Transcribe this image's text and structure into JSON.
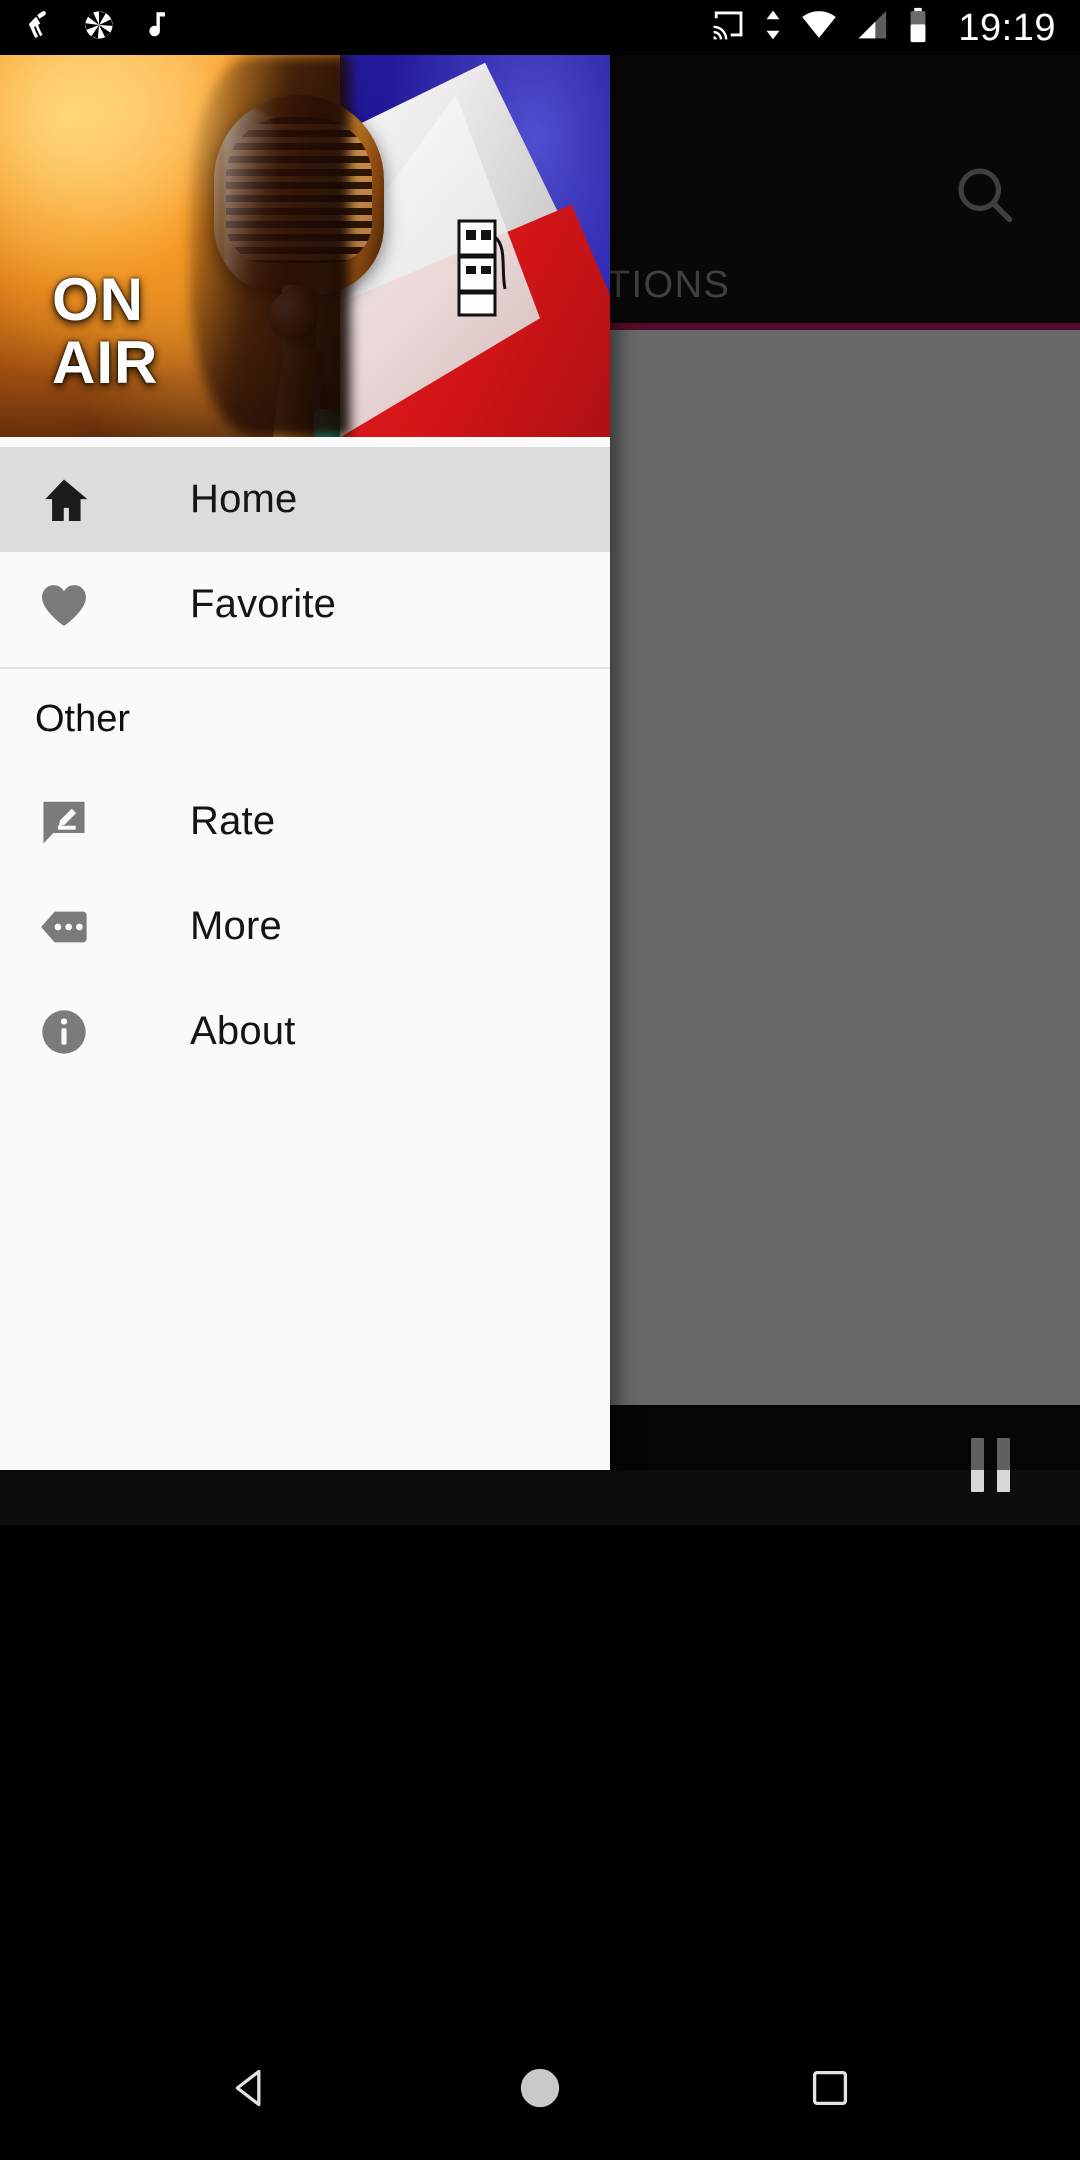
{
  "status_bar": {
    "time": "19:19",
    "left_icons": [
      {
        "name": "cleaner-icon",
        "label": "cleaner"
      },
      {
        "name": "camera-aperture-icon",
        "label": "camera"
      },
      {
        "name": "music-note-icon",
        "label": "music"
      }
    ],
    "right_icons": [
      {
        "name": "cast-icon",
        "label": "cast"
      },
      {
        "name": "data-transfer-icon",
        "label": "data transfer"
      },
      {
        "name": "wifi-icon",
        "label": "wifi"
      },
      {
        "name": "cellular-signal-icon",
        "label": "signal"
      },
      {
        "name": "battery-icon",
        "label": "battery"
      }
    ]
  },
  "app": {
    "toolbar": {
      "search_icon": "search-icon"
    },
    "tabs": [
      {
        "label": "STATIONS",
        "selected": true
      }
    ],
    "accent_color": "#c2185b",
    "player": {
      "transport_icon": "pause-icon",
      "state": "playing"
    }
  },
  "drawer": {
    "header": {
      "on_air_line1": "ON",
      "on_air_line2": "AIR",
      "artwork": "vintage-microphone-with-flag"
    },
    "items": [
      {
        "label": "Home",
        "icon": "home-icon",
        "selected": true,
        "name": "sidebar-item-home"
      },
      {
        "label": "Favorite",
        "icon": "heart-icon",
        "selected": false,
        "name": "sidebar-item-favorite"
      }
    ],
    "section_title": "Other",
    "other_items": [
      {
        "label": "Rate",
        "icon": "rate-review-icon",
        "selected": false,
        "name": "sidebar-item-rate"
      },
      {
        "label": "More",
        "icon": "more-tag-icon",
        "selected": false,
        "name": "sidebar-item-more"
      },
      {
        "label": "About",
        "icon": "info-icon",
        "selected": false,
        "name": "sidebar-item-about"
      }
    ]
  },
  "nav_bar": {
    "buttons": [
      {
        "name": "back-button",
        "icon": "triangle-back-icon"
      },
      {
        "name": "home-button",
        "icon": "circle-home-icon"
      },
      {
        "name": "recents-button",
        "icon": "square-recents-icon"
      }
    ]
  }
}
